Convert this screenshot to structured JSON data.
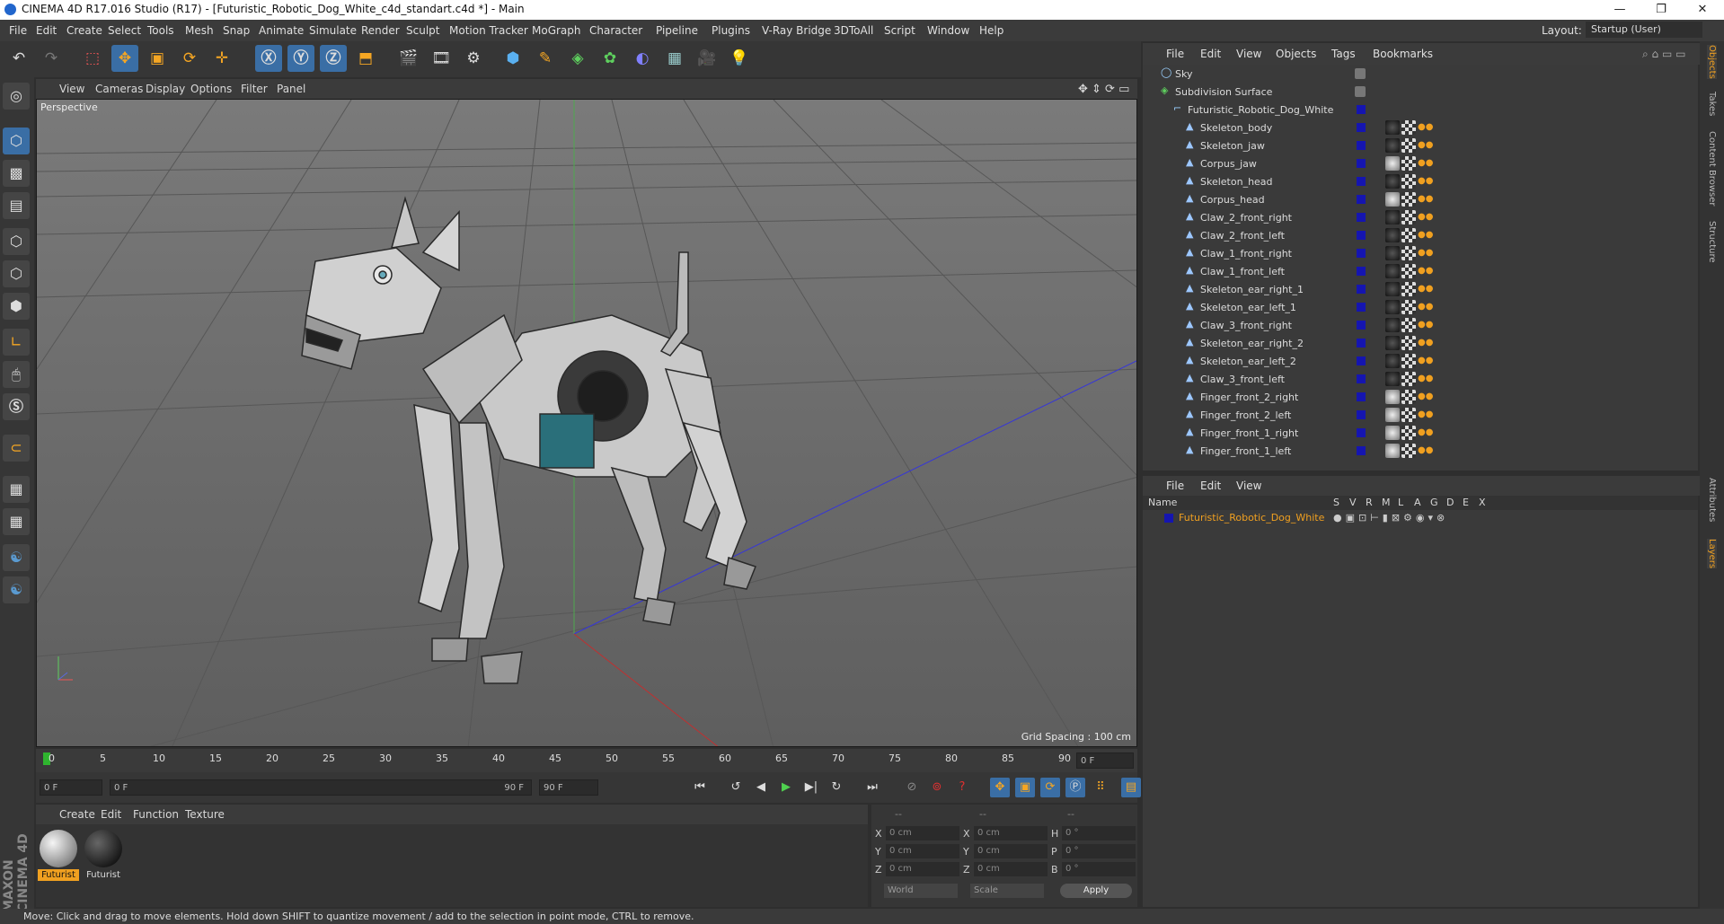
{
  "window": {
    "title": "CINEMA 4D R17.016 Studio (R17) - [Futuristic_Robotic_Dog_White_c4d_standart.c4d *] - Main",
    "controls": [
      "—",
      "❐",
      "✕"
    ]
  },
  "menubar": {
    "items": [
      "File",
      "Edit",
      "Create",
      "Select",
      "Tools",
      "Mesh",
      "Snap",
      "Animate",
      "Simulate",
      "Render",
      "Sculpt",
      "Motion Tracker",
      "MoGraph",
      "Character",
      "Pipeline",
      "Plugins",
      "V-Ray Bridge",
      "3DToAll",
      "Script",
      "Window",
      "Help"
    ],
    "layout_label": "Layout:",
    "layout_value": "Startup (User)"
  },
  "viewport": {
    "menu": [
      "View",
      "Cameras",
      "Display",
      "Options",
      "Filter",
      "Panel"
    ],
    "camera_label": "Perspective",
    "grid_spacing": "Grid Spacing : 100 cm"
  },
  "timeline": {
    "ticks": [
      "0",
      "5",
      "10",
      "15",
      "20",
      "25",
      "30",
      "35",
      "40",
      "45",
      "50",
      "55",
      "60",
      "65",
      "70",
      "75",
      "80",
      "85",
      "90"
    ],
    "frame_display": "0 F",
    "start_field": "0 F",
    "slider_start": "0 F",
    "slider_end": "90 F",
    "end_field": "90 F"
  },
  "materials": {
    "menu": [
      "Create",
      "Edit",
      "Function",
      "Texture"
    ],
    "items": [
      {
        "label": "Futurist",
        "selected": true
      },
      {
        "label": "Futurist",
        "selected": false
      }
    ]
  },
  "coords": {
    "headers": [
      "--",
      "--",
      "--"
    ],
    "rows": [
      {
        "a": "X",
        "av": "0 cm",
        "b": "X",
        "bv": "0 cm",
        "c": "H",
        "cv": "0 °"
      },
      {
        "a": "Y",
        "av": "0 cm",
        "b": "Y",
        "bv": "0 cm",
        "c": "P",
        "cv": "0 °"
      },
      {
        "a": "Z",
        "av": "0 cm",
        "b": "Z",
        "bv": "0 cm",
        "c": "B",
        "cv": "0 °"
      }
    ],
    "world": "World",
    "scale": "Scale",
    "apply": "Apply"
  },
  "status": {
    "text": "Move: Click and drag to move elements. Hold down SHIFT to quantize movement / add to the selection in point mode, CTRL to remove."
  },
  "object_manager": {
    "menu": [
      "File",
      "Edit",
      "View",
      "Objects",
      "Tags",
      "Bookmarks"
    ],
    "objects": [
      {
        "name": "Sky",
        "indent": 0,
        "type": "sky"
      },
      {
        "name": "Subdivision Surface",
        "indent": 0,
        "type": "subd"
      },
      {
        "name": "Futuristic_Robotic_Dog_White",
        "indent": 1,
        "type": "null"
      },
      {
        "name": "Skeleton_body",
        "indent": 2,
        "type": "bone",
        "mat": "dark"
      },
      {
        "name": "Skeleton_jaw",
        "indent": 2,
        "type": "bone",
        "mat": "dark"
      },
      {
        "name": "Corpus_jaw",
        "indent": 2,
        "type": "bone",
        "mat": "light"
      },
      {
        "name": "Skeleton_head",
        "indent": 2,
        "type": "bone",
        "mat": "dark"
      },
      {
        "name": "Corpus_head",
        "indent": 2,
        "type": "bone",
        "mat": "light"
      },
      {
        "name": "Claw_2_front_right",
        "indent": 2,
        "type": "bone",
        "mat": "dark"
      },
      {
        "name": "Claw_2_front_left",
        "indent": 2,
        "type": "bone",
        "mat": "dark"
      },
      {
        "name": "Claw_1_front_right",
        "indent": 2,
        "type": "bone",
        "mat": "dark"
      },
      {
        "name": "Claw_1_front_left",
        "indent": 2,
        "type": "bone",
        "mat": "dark"
      },
      {
        "name": "Skeleton_ear_right_1",
        "indent": 2,
        "type": "bone",
        "mat": "dark"
      },
      {
        "name": "Skeleton_ear_left_1",
        "indent": 2,
        "type": "bone",
        "mat": "dark"
      },
      {
        "name": "Claw_3_front_right",
        "indent": 2,
        "type": "bone",
        "mat": "dark"
      },
      {
        "name": "Skeleton_ear_right_2",
        "indent": 2,
        "type": "bone",
        "mat": "dark"
      },
      {
        "name": "Skeleton_ear_left_2",
        "indent": 2,
        "type": "bone",
        "mat": "dark"
      },
      {
        "name": "Claw_3_front_left",
        "indent": 2,
        "type": "bone",
        "mat": "dark"
      },
      {
        "name": "Finger_front_2_right",
        "indent": 2,
        "type": "bone",
        "mat": "light"
      },
      {
        "name": "Finger_front_2_left",
        "indent": 2,
        "type": "bone",
        "mat": "light"
      },
      {
        "name": "Finger_front_1_right",
        "indent": 2,
        "type": "bone",
        "mat": "light"
      },
      {
        "name": "Finger_front_1_left",
        "indent": 2,
        "type": "bone",
        "mat": "light"
      }
    ]
  },
  "layer_manager": {
    "menu": [
      "File",
      "Edit",
      "View"
    ],
    "columns": [
      "Name",
      "S",
      "V",
      "R",
      "M",
      "L",
      "A",
      "G",
      "D",
      "E",
      "X"
    ],
    "layer_name": "Futuristic_Robotic_Dog_White"
  },
  "right_tabs": [
    "Objects",
    "Takes",
    "Content Browser",
    "Structure"
  ],
  "right_tabs_lower": [
    "Attributes",
    "Layers"
  ],
  "colors": {
    "accent_blue": "#3a6ea5",
    "selected_orange": "#f0a020",
    "layer_swatch": "#1515b0"
  }
}
